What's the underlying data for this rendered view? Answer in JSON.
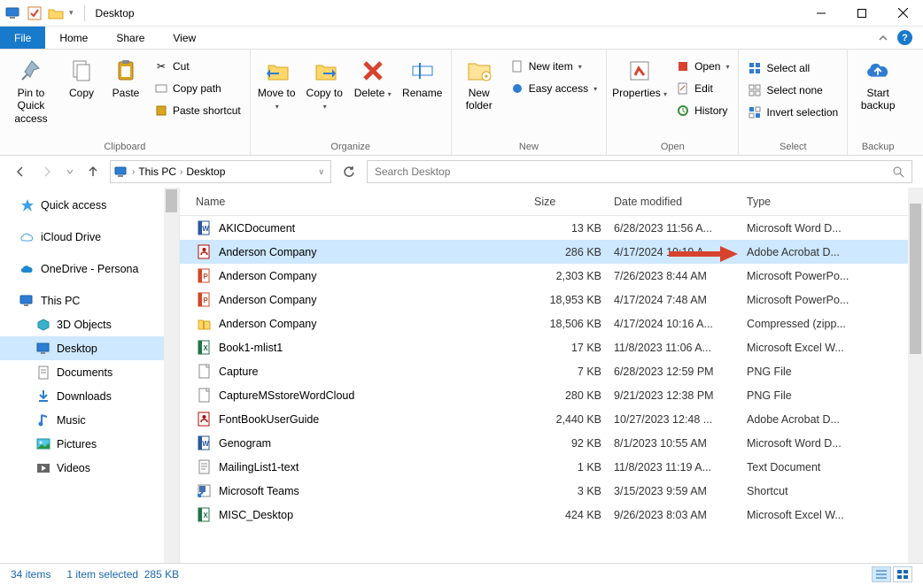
{
  "window": {
    "title": "Desktop"
  },
  "tabs": {
    "file": "File",
    "home": "Home",
    "share": "Share",
    "view": "View"
  },
  "ribbon": {
    "clipboard": {
      "label": "Clipboard",
      "pin": "Pin to Quick access",
      "copy": "Copy",
      "paste": "Paste",
      "cut": "Cut",
      "copy_path": "Copy path",
      "paste_shortcut": "Paste shortcut"
    },
    "organize": {
      "label": "Organize",
      "move_to": "Move to",
      "copy_to": "Copy to",
      "delete": "Delete",
      "rename": "Rename"
    },
    "new": {
      "label": "New",
      "new_folder": "New folder",
      "new_item": "New item",
      "easy_access": "Easy access"
    },
    "open": {
      "label": "Open",
      "properties": "Properties",
      "open": "Open",
      "edit": "Edit",
      "history": "History"
    },
    "select": {
      "label": "Select",
      "select_all": "Select all",
      "select_none": "Select none",
      "invert": "Invert selection"
    },
    "backup": {
      "label": "Backup",
      "start": "Start backup"
    }
  },
  "breadcrumb": {
    "root": "This PC",
    "leaf": "Desktop"
  },
  "search": {
    "placeholder": "Search Desktop"
  },
  "columns": {
    "name": "Name",
    "size": "Size",
    "date": "Date modified",
    "type": "Type"
  },
  "sidebar": {
    "quick_access": "Quick access",
    "icloud": "iCloud Drive",
    "onedrive": "OneDrive - Persona",
    "this_pc": "This PC",
    "objects3d": "3D Objects",
    "desktop": "Desktop",
    "documents": "Documents",
    "downloads": "Downloads",
    "music": "Music",
    "pictures": "Pictures",
    "videos": "Videos"
  },
  "files": [
    {
      "icon": "word",
      "name": "AKICDocument",
      "size": "13 KB",
      "date": "6/28/2023 11:56 A...",
      "type": "Microsoft Word D..."
    },
    {
      "icon": "pdf",
      "name": "Anderson Company",
      "size": "286 KB",
      "date": "4/17/2024 10:19 A...",
      "type": "Adobe Acrobat D...",
      "selected": true
    },
    {
      "icon": "ppt",
      "name": "Anderson Company",
      "size": "2,303 KB",
      "date": "7/26/2023 8:44 AM",
      "type": "Microsoft PowerPo..."
    },
    {
      "icon": "ppt",
      "name": "Anderson Company",
      "size": "18,953 KB",
      "date": "4/17/2024 7:48 AM",
      "type": "Microsoft PowerPo..."
    },
    {
      "icon": "zip",
      "name": "Anderson Company",
      "size": "18,506 KB",
      "date": "4/17/2024 10:16 A...",
      "type": "Compressed (zipp..."
    },
    {
      "icon": "excel",
      "name": "Book1-mlist1",
      "size": "17 KB",
      "date": "11/8/2023 11:06 A...",
      "type": "Microsoft Excel W..."
    },
    {
      "icon": "file",
      "name": "Capture",
      "size": "7 KB",
      "date": "6/28/2023 12:59 PM",
      "type": "PNG File"
    },
    {
      "icon": "file",
      "name": "CaptureMSstoreWordCloud",
      "size": "280 KB",
      "date": "9/21/2023 12:38 PM",
      "type": "PNG File"
    },
    {
      "icon": "pdf",
      "name": "FontBookUserGuide",
      "size": "2,440 KB",
      "date": "10/27/2023 12:48 ...",
      "type": "Adobe Acrobat D..."
    },
    {
      "icon": "word",
      "name": "Genogram",
      "size": "92 KB",
      "date": "8/1/2023 10:55 AM",
      "type": "Microsoft Word D..."
    },
    {
      "icon": "text",
      "name": "MailingList1-text",
      "size": "1 KB",
      "date": "11/8/2023 11:19 A...",
      "type": "Text Document"
    },
    {
      "icon": "link",
      "name": "Microsoft Teams",
      "size": "3 KB",
      "date": "3/15/2023 9:59 AM",
      "type": "Shortcut"
    },
    {
      "icon": "excel",
      "name": "MISC_Desktop",
      "size": "424 KB",
      "date": "9/26/2023 8:03 AM",
      "type": "Microsoft Excel W..."
    }
  ],
  "status": {
    "items": "34 items",
    "selected": "1 item selected",
    "size": "285 KB"
  },
  "colors": {
    "accent": "#1979ca",
    "selection": "#cde8ff",
    "arrow": "#d8432f"
  }
}
